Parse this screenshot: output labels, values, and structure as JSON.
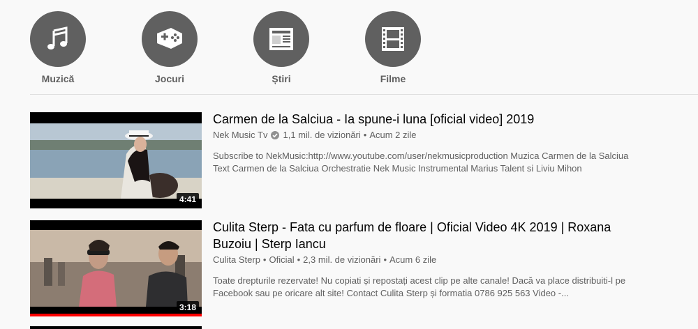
{
  "categories": [
    {
      "label": "Muzică",
      "icon": "music-note-icon"
    },
    {
      "label": "Jocuri",
      "icon": "gamepad-icon"
    },
    {
      "label": "Știri",
      "icon": "newspaper-icon"
    },
    {
      "label": "Filme",
      "icon": "film-strip-icon"
    }
  ],
  "videos": [
    {
      "title": "Carmen de la Salciua - Ia spune-i luna [oficial video] 2019",
      "channel": "Nek Music Tv",
      "verified": true,
      "views": "1,1 mil. de vizionări",
      "age": "Acum 2 zile",
      "description": "Subscribe to NekMusic:http://www.youtube.com/user/nekmusicproduction Muzica Carmen de la Salciua Text Carmen de la Salciua Orchestratie Nek Music Instrumental Marius Talent si Liviu Mihon",
      "duration": "4:41"
    },
    {
      "title": "Culita Sterp - Fata cu parfum de floare | Oficial Video 4K 2019 | Roxana Buzoiu | Sterp Iancu",
      "channel": "Culita Sterp",
      "official_tag": "Oficial",
      "views": "2,3 mil. de vizionări",
      "age": "Acum 6 zile",
      "description": "Toate drepturile rezervate! Nu copiati și repostați acest clip pe alte canale! Dacă va place distribuiti-l pe Facebook sau pe oricare alt site! Contact Culita Sterp și formatia 0786 925 563 Video -...",
      "duration": "3:18",
      "watched_fraction": 1.0
    }
  ],
  "colors": {
    "background": "#f9f9f9",
    "category_circle": "#606060",
    "secondary_text": "#606060",
    "progress": "#ff0000"
  }
}
